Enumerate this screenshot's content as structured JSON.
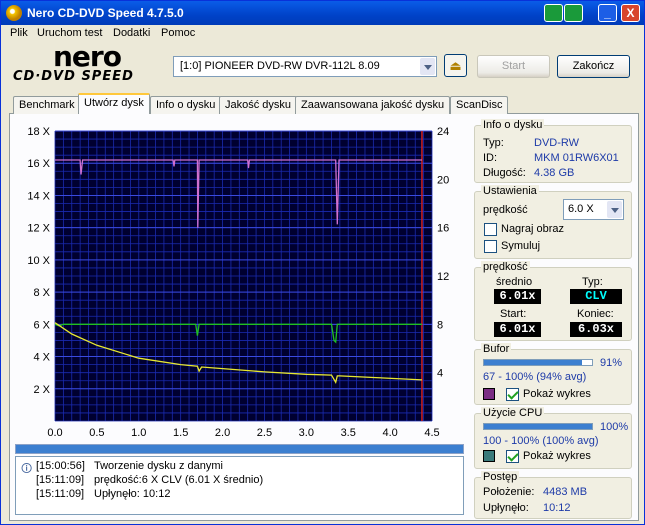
{
  "window": {
    "title": "Nero CD-DVD Speed 4.7.5.0",
    "minimize": "_",
    "close": "X"
  },
  "menu": [
    "Plik",
    "Uruchom test",
    "Dodatki",
    "Pomoc"
  ],
  "logo": {
    "brand": "nero",
    "product": "CD·DVD SPEED"
  },
  "drive": {
    "selected": "[1:0]  PIONEER DVD-RW  DVR-112L 8.09"
  },
  "buttons": {
    "start": "Start",
    "end": "Zakończ"
  },
  "tabs": [
    "Benchmark",
    "Utwórz dysk",
    "Info o dysku",
    "Jakość dysku",
    "Zaawansowana jakość dysku",
    "ScanDisc"
  ],
  "active_tab": 1,
  "info": {
    "title": "Info o dysku",
    "type_label": "Typ:",
    "type_value": "DVD-RW",
    "id_label": "ID:",
    "id_value": "MKM 01RW6X01",
    "len_label": "Długość:",
    "len_value": "4.38 GB"
  },
  "settings": {
    "title": "Ustawienia",
    "speed_label": "prędkość",
    "speed_value": "6.0 X",
    "record_label": "Nagraj obraz",
    "simulate_label": "Symuluj"
  },
  "speed": {
    "title": "prędkość",
    "avg_label": "średnio",
    "avg_value": "6.01x",
    "type_label": "Typ:",
    "type_value": "CLV",
    "start_label": "Start:",
    "start_value": "6.01x",
    "end_label": "Koniec:",
    "end_value": "6.03x"
  },
  "buffer": {
    "title": "Bufor",
    "percent": "91%",
    "fill": 0.91,
    "range": "67 - 100% (94% avg)",
    "show_label": "Pokaż wykres",
    "color": "#7b2e84"
  },
  "cpu": {
    "title": "Użycie CPU",
    "percent": "100%",
    "fill": 1.0,
    "range": "100 - 100% (100% avg)",
    "show_label": "Pokaż wykres",
    "color": "#3a7a7a"
  },
  "progress": {
    "title": "Postęp",
    "pos_label": "Położenie:",
    "pos_value": "4483 MB",
    "elapsed_label": "Upłynęło:",
    "elapsed_value": "10:12",
    "bar_fill": 1.0
  },
  "log": [
    {
      "time": "[15:00:56]",
      "msg": "Tworzenie dysku z danymi"
    },
    {
      "time": "[15:11:09]",
      "msg": "prędkość:6 X CLV (6.01 X średnio)"
    },
    {
      "time": "[15:11:09]",
      "msg": "Upłynęło: 10:12"
    }
  ],
  "chart_data": {
    "type": "line",
    "x_ticks": [
      "0.0",
      "0.5",
      "1.0",
      "1.5",
      "2.0",
      "2.5",
      "3.0",
      "3.5",
      "4.0",
      "4.5"
    ],
    "y_left_ticks": [
      "2 X",
      "4 X",
      "6 X",
      "8 X",
      "10 X",
      "12 X",
      "14 X",
      "16 X",
      "18 X"
    ],
    "y_right_ticks": [
      "4",
      "8",
      "12",
      "16",
      "20",
      "24"
    ],
    "xlim": [
      0,
      4.5
    ],
    "ylim_left": [
      0,
      18
    ],
    "ylim_right": [
      0,
      24
    ],
    "grid": true,
    "series": [
      {
        "color": "#20c020",
        "x": [
          0,
          0.05,
          0.1,
          0.3,
          0.6,
          1.0,
          1.5,
          1.68,
          1.7,
          1.72,
          2.0,
          2.5,
          3.0,
          3.3,
          3.33,
          3.35,
          3.37,
          3.4,
          3.8,
          4.2,
          4.3,
          4.38
        ],
        "y": [
          6.0,
          5.9,
          6.0,
          6.0,
          6.0,
          6.0,
          6.0,
          6.0,
          5.3,
          6.0,
          6.0,
          6.0,
          6.0,
          6.0,
          5.0,
          4.9,
          6.0,
          6.0,
          6.0,
          6.0,
          6.0,
          6.0
        ]
      },
      {
        "color": "#e8e830",
        "x": [
          0,
          0.2,
          0.5,
          1.0,
          1.5,
          1.7,
          1.72,
          1.75,
          2.0,
          2.5,
          3.0,
          3.3,
          3.35,
          3.37,
          3.4,
          3.8,
          4.2,
          4.38
        ],
        "y": [
          6.1,
          5.4,
          4.7,
          3.9,
          3.5,
          3.4,
          3.1,
          3.35,
          3.25,
          3.05,
          2.9,
          2.85,
          2.4,
          2.8,
          2.8,
          2.7,
          2.6,
          2.55
        ]
      },
      {
        "color": "#d070d0",
        "x": [
          0,
          0.3,
          0.31,
          0.33,
          1.0,
          1.41,
          1.42,
          1.43,
          1.7,
          1.705,
          1.72,
          2.0,
          2.3,
          2.31,
          2.32,
          3.35,
          3.37,
          3.39,
          3.8,
          4.2,
          4.38
        ],
        "y": [
          16.2,
          16.2,
          15.3,
          16.2,
          16.2,
          16.2,
          15.8,
          16.2,
          16.2,
          12.0,
          16.2,
          16.2,
          16.2,
          15.7,
          16.2,
          16.2,
          12.2,
          16.2,
          16.2,
          16.2,
          16.2
        ]
      }
    ]
  }
}
